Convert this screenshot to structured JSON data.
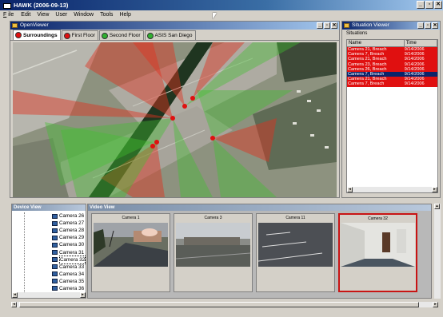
{
  "app": {
    "title": "HAWK (2006-09-13)",
    "window_buttons": [
      "_",
      "▫",
      "✕"
    ]
  },
  "menu": {
    "file_ul": "F",
    "file_rest": "ile",
    "edit": "Edit",
    "view": "View",
    "user": "User",
    "window": "Window",
    "tools": "Tools",
    "help": "Help"
  },
  "open_viewer": {
    "title": "OpenViewer",
    "buttons": [
      "_",
      "▫",
      "✕"
    ],
    "tabs": [
      {
        "label": "Surroundings",
        "color": "#e01010"
      },
      {
        "label": "First Floor",
        "color": "#e01010"
      },
      {
        "label": "Second Floor",
        "color": "#30b030"
      },
      {
        "label": "ASIS San Diego",
        "color": "#30b030"
      }
    ]
  },
  "situation_viewer": {
    "title": "Situation Viewer",
    "buttons": [
      "_",
      "▫",
      "✕"
    ],
    "section_label": "Situations",
    "columns": [
      "Name",
      "Time"
    ],
    "rows": [
      {
        "name": "Camera 21, Breach",
        "time": "9/14/2006"
      },
      {
        "name": "Camera 7, Breach",
        "time": "9/14/2006"
      },
      {
        "name": "Camera 21, Breach",
        "time": "9/14/2006"
      },
      {
        "name": "Camera 23, Breach",
        "time": "9/14/2006"
      },
      {
        "name": "Camera 26, Breach",
        "time": "9/14/2006"
      },
      {
        "name": "Camera 7, Breach",
        "time": "9/14/2006"
      },
      {
        "name": "Camera 21, Breach",
        "time": "9/14/2006"
      },
      {
        "name": "Camera 7, Breach",
        "time": "9/14/2006"
      }
    ],
    "selected_index": 5,
    "breach_color": "#e01010",
    "selected_color": "#0a246a"
  },
  "device_view": {
    "title": "Device View",
    "cameras": [
      "Camera 26",
      "Camera 27",
      "Camera 28",
      "Camera 29",
      "Camera 30",
      "Camera 31",
      "Camera 32",
      "Camera 33",
      "Camera 34",
      "Camera 35",
      "Camera 36"
    ],
    "selected_camera": "Camera 32"
  },
  "video_view": {
    "title": "Video View",
    "frames": [
      {
        "label": "Camera 1"
      },
      {
        "label": "Camera 3"
      },
      {
        "label": "Camera 11"
      },
      {
        "label": "Camera 32"
      }
    ],
    "selected_frame": 3,
    "selected_border_color": "#c81414"
  },
  "icons": {
    "app": "window-icon",
    "viewer": "folder-icon",
    "camera": "camera-icon"
  }
}
